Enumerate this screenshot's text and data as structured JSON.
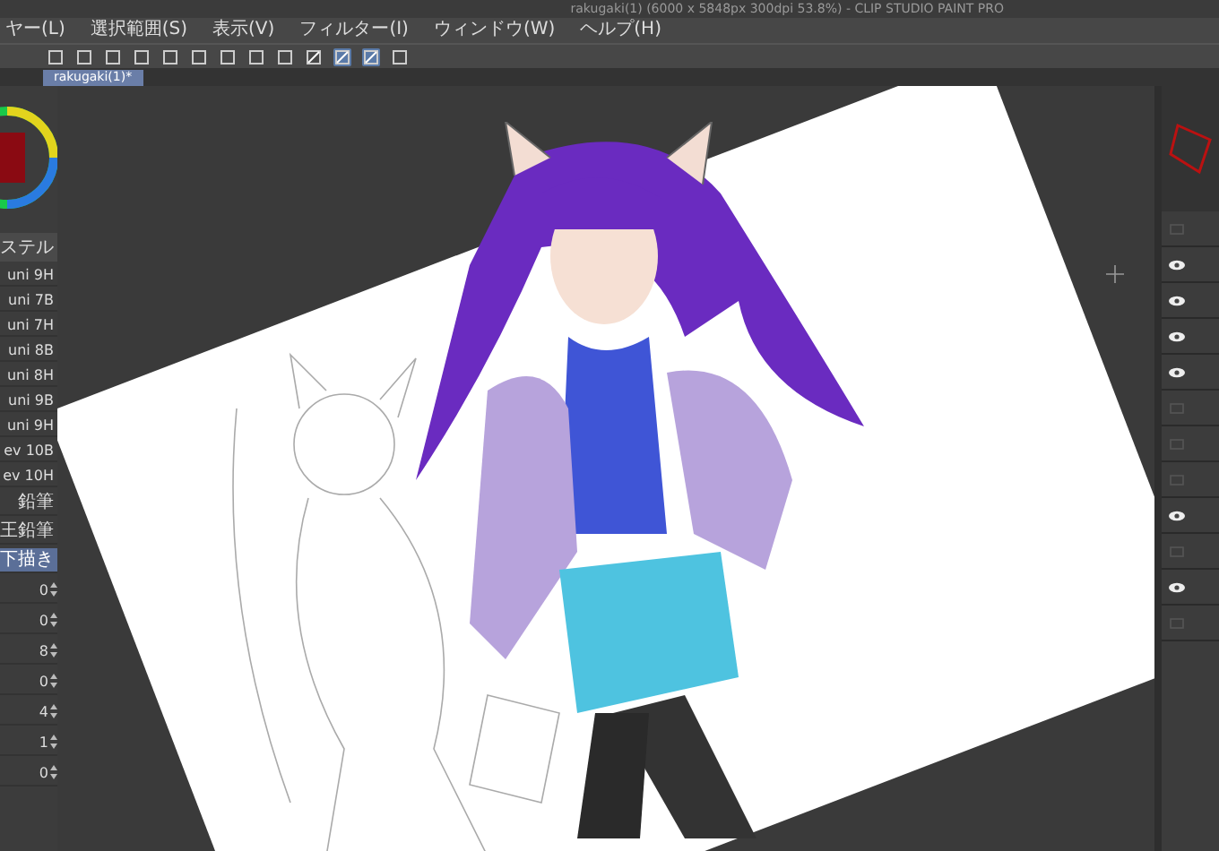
{
  "window": {
    "title": "rakugaki(1) (6000 x 5848px 300dpi 53.8%) - CLIP STUDIO PAINT PRO"
  },
  "menu": [
    {
      "label": "ヤー(L)"
    },
    {
      "label": "選択範囲(S)"
    },
    {
      "label": "表示(V)"
    },
    {
      "label": "フィルター(I)"
    },
    {
      "label": "ウィンドウ(W)"
    },
    {
      "label": "ヘルプ(H)"
    }
  ],
  "document_tabs": [
    {
      "label": "rakugaki(1)*",
      "selected": true
    }
  ],
  "brush_panel": {
    "header": "ステル",
    "items": [
      {
        "label": "uni 9H",
        "selected": false
      },
      {
        "label": "uni 7B",
        "selected": false
      },
      {
        "label": "uni 7H",
        "selected": false
      },
      {
        "label": "uni 8B",
        "selected": false
      },
      {
        "label": "uni 8H",
        "selected": false
      },
      {
        "label": "uni 9B",
        "selected": false
      },
      {
        "label": "uni 9H",
        "selected": false
      },
      {
        "label": "ev 10B",
        "selected": false
      },
      {
        "label": "ev 10H",
        "selected": false
      },
      {
        "label": "鉛筆",
        "selected": false
      },
      {
        "label": "王鉛筆",
        "selected": false
      },
      {
        "label": "下描き",
        "selected": true
      }
    ]
  },
  "properties": [
    {
      "value": "0"
    },
    {
      "value": "0"
    },
    {
      "value": "8"
    },
    {
      "value": "0"
    },
    {
      "value": "4"
    },
    {
      "value": "1"
    },
    {
      "value": "0"
    }
  ],
  "layers": [
    {
      "visible": false
    },
    {
      "visible": true
    },
    {
      "visible": true
    },
    {
      "visible": true
    },
    {
      "visible": true
    },
    {
      "visible": false
    },
    {
      "visible": false
    },
    {
      "visible": false
    },
    {
      "visible": true
    },
    {
      "visible": false
    },
    {
      "visible": true
    },
    {
      "visible": false
    }
  ]
}
